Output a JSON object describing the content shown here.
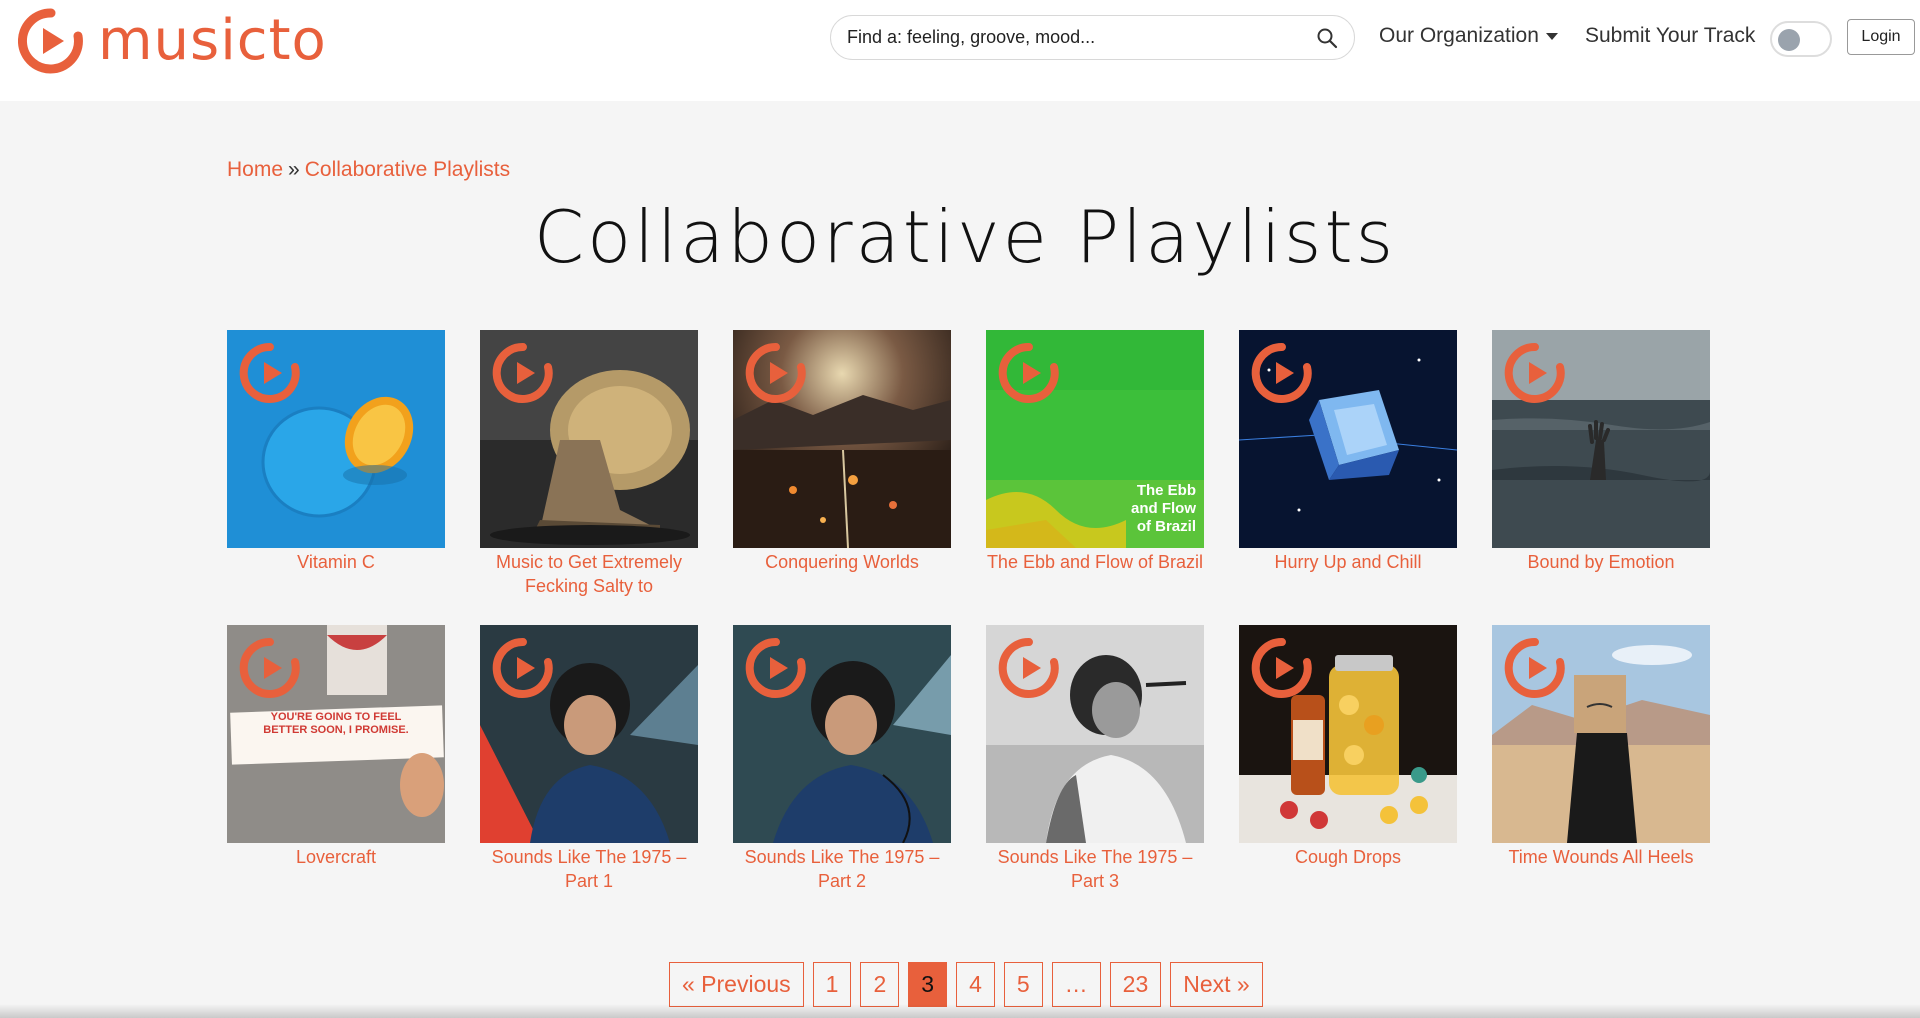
{
  "brand": {
    "name": "musicto",
    "accent": "#e8603c"
  },
  "search": {
    "placeholder": "Find a: feeling, groove, mood..."
  },
  "nav": {
    "organization": "Our Organization",
    "submit": "Submit Your Track",
    "login": "Login"
  },
  "breadcrumb": {
    "home": "Home",
    "separator": "»",
    "current": "Collaborative Playlists"
  },
  "page_title": "Collaborative Playlists",
  "playlists": [
    {
      "title": "Vitamin C"
    },
    {
      "title": "Music to Get Extremely Fecking Salty to"
    },
    {
      "title": "Conquering Worlds"
    },
    {
      "title": "The Ebb and Flow of Brazil",
      "caption": "The Ebb and Flow of Brazil"
    },
    {
      "title": "Hurry Up and Chill"
    },
    {
      "title": "Bound by Emotion"
    },
    {
      "title": "Lovercraft",
      "note": "YOU'RE GOING TO FEEL BETTER SOON, I PROMISE."
    },
    {
      "title": "Sounds Like The 1975 – Part 1"
    },
    {
      "title": "Sounds Like The 1975 – Part 2"
    },
    {
      "title": "Sounds Like The 1975 – Part 3"
    },
    {
      "title": "Cough Drops"
    },
    {
      "title": "Time Wounds All Heels"
    }
  ],
  "pagination": {
    "previous": "« Previous",
    "pages": [
      "1",
      "2",
      "3",
      "4",
      "5",
      "…",
      "23"
    ],
    "current": "3",
    "next": "Next »"
  }
}
